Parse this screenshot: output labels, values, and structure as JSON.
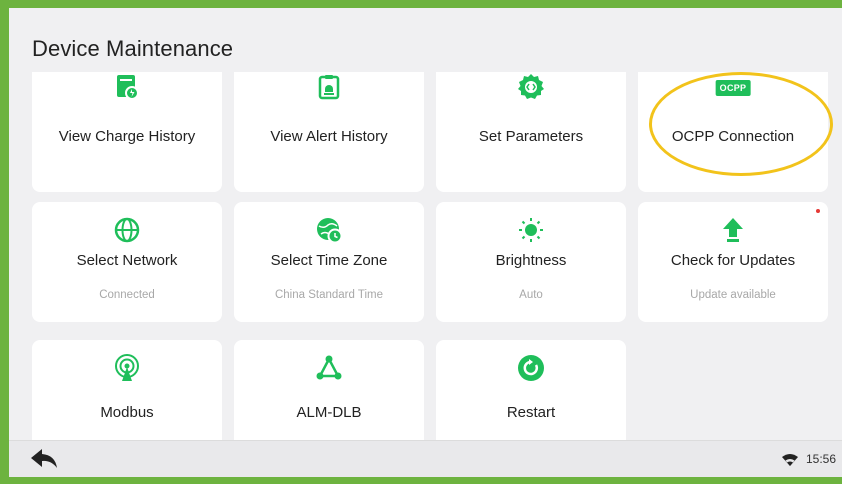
{
  "header": {
    "title": "Device Maintenance"
  },
  "tiles": [
    {
      "label": "View Charge History",
      "subtitle": "",
      "icon": "charge-history-icon"
    },
    {
      "label": "View Alert History",
      "subtitle": "",
      "icon": "alert-history-icon"
    },
    {
      "label": "Set Parameters",
      "subtitle": "",
      "icon": "settings-gear-icon"
    },
    {
      "label": "OCPP Connection",
      "subtitle": "",
      "icon": "ocpp-icon",
      "badge_text": "OCPP"
    },
    {
      "label": "Select Network",
      "subtitle": "Connected",
      "icon": "network-globe-icon"
    },
    {
      "label": "Select Time Zone",
      "subtitle": "China Standard Time",
      "icon": "timezone-globe-icon"
    },
    {
      "label": "Brightness",
      "subtitle": "Auto",
      "icon": "sun-icon"
    },
    {
      "label": "Check for Updates",
      "subtitle": "Update available",
      "icon": "update-arrow-icon",
      "notification_dot": true
    },
    {
      "label": "Modbus",
      "subtitle": "",
      "icon": "antenna-icon"
    },
    {
      "label": "ALM-DLB",
      "subtitle": "",
      "icon": "triangle-nodes-icon"
    },
    {
      "label": "Restart",
      "subtitle": "",
      "icon": "restart-icon"
    }
  ],
  "statusbar": {
    "time": "15:56",
    "wifi_icon": "wifi-icon",
    "back_icon": "back-arrow-icon"
  },
  "colors": {
    "accent": "#1fbe5a",
    "frame": "#6db33f",
    "highlight": "#f2c31b",
    "dot": "#e53935"
  }
}
